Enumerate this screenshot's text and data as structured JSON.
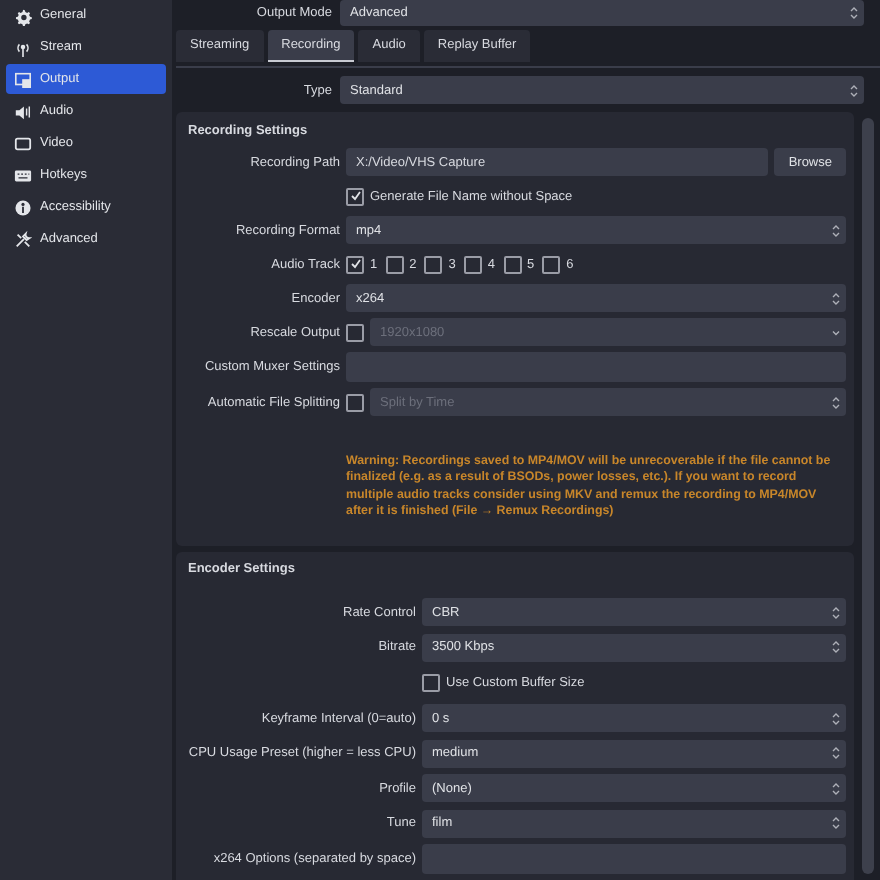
{
  "sidebar": {
    "items": [
      {
        "label": "General",
        "selected": false
      },
      {
        "label": "Stream",
        "selected": false
      },
      {
        "label": "Output",
        "selected": true
      },
      {
        "label": "Audio",
        "selected": false
      },
      {
        "label": "Video",
        "selected": false
      },
      {
        "label": "Hotkeys",
        "selected": false
      },
      {
        "label": "Accessibility",
        "selected": false
      },
      {
        "label": "Advanced",
        "selected": false
      }
    ]
  },
  "output_mode": {
    "label": "Output Mode",
    "value": "Advanced"
  },
  "tabs": [
    {
      "label": "Streaming",
      "selected": false
    },
    {
      "label": "Recording",
      "selected": true
    },
    {
      "label": "Audio",
      "selected": false
    },
    {
      "label": "Replay Buffer",
      "selected": false
    }
  ],
  "type": {
    "label": "Type",
    "value": "Standard"
  },
  "recording_settings": {
    "title": "Recording Settings",
    "rows": [
      {
        "kind": "path",
        "label": "Recording Path",
        "value": "X:/Video/VHS Capture",
        "button": "Browse"
      },
      {
        "kind": "checkbox",
        "label": "Generate File Name without Space",
        "checked": true
      },
      {
        "kind": "combo",
        "label": "Recording Format",
        "value": "mp4"
      },
      {
        "kind": "tracks",
        "label": "Audio Track",
        "tracks": [
          {
            "label": "1",
            "checked": true
          },
          {
            "label": "2",
            "checked": false
          },
          {
            "label": "3",
            "checked": false
          },
          {
            "label": "4",
            "checked": false
          },
          {
            "label": "5",
            "checked": false
          },
          {
            "label": "6",
            "checked": false
          }
        ]
      },
      {
        "kind": "combo",
        "label": "Encoder",
        "value": "x264"
      },
      {
        "kind": "checkcombo",
        "label": "Rescale Output",
        "checked": false,
        "value": "1920x1080"
      },
      {
        "kind": "text",
        "label": "Custom Muxer Settings"
      },
      {
        "kind": "checkcombo",
        "label": "Automatic File Splitting",
        "checked": false,
        "value": "Split by Time"
      }
    ],
    "warning": "Warning: Recordings saved to MP4/MOV will be unrecoverable if the file cannot be finalized (e.g. as a result of BSODs, power losses, etc.). If you want to record multiple audio tracks consider using MKV and remux the recording to MP4/MOV after it is finished (File → Remux Recordings)"
  },
  "encoder_settings": {
    "title": "Encoder Settings",
    "rows": [
      {
        "kind": "combo",
        "label": "Rate Control",
        "value": "CBR"
      },
      {
        "kind": "spin",
        "label": "Bitrate",
        "value": "3500 Kbps"
      },
      {
        "kind": "checkbox",
        "label": "Use Custom Buffer Size",
        "checked": false
      },
      {
        "kind": "spin",
        "label": "Keyframe Interval (0=auto)",
        "value": "0 s"
      },
      {
        "kind": "combo",
        "label": "CPU Usage Preset (higher = less CPU)",
        "value": "medium"
      },
      {
        "kind": "combo",
        "label": "Profile",
        "value": "(None)"
      },
      {
        "kind": "combo",
        "label": "Tune",
        "value": "film"
      },
      {
        "kind": "text",
        "label": "x264 Options (separated by space)"
      }
    ]
  }
}
